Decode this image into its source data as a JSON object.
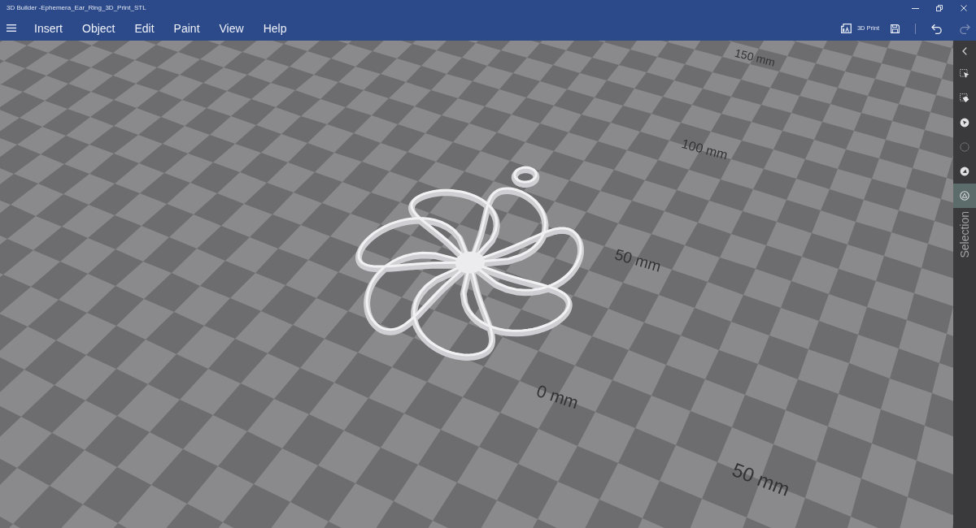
{
  "window": {
    "title": "3D Builder -Ephemera_Ear_Ring_3D_Print_STL"
  },
  "menu": [
    "Insert",
    "Object",
    "Edit",
    "Paint",
    "View",
    "Help"
  ],
  "toolbar": {
    "print_label": "3D Print",
    "undo": {
      "disabled": false
    },
    "redo": {
      "disabled": true
    }
  },
  "viewport": {
    "ruler_labels": [
      "150 mm",
      "100 mm",
      "50 mm",
      "0 mm",
      "50 mm"
    ]
  },
  "side_panel": {
    "tools": [
      {
        "selected": false
      },
      {
        "selected": false
      },
      {
        "selected": false
      },
      {
        "selected": false
      },
      {
        "selected": false
      },
      {
        "selected": true
      }
    ],
    "label": "Selection"
  }
}
